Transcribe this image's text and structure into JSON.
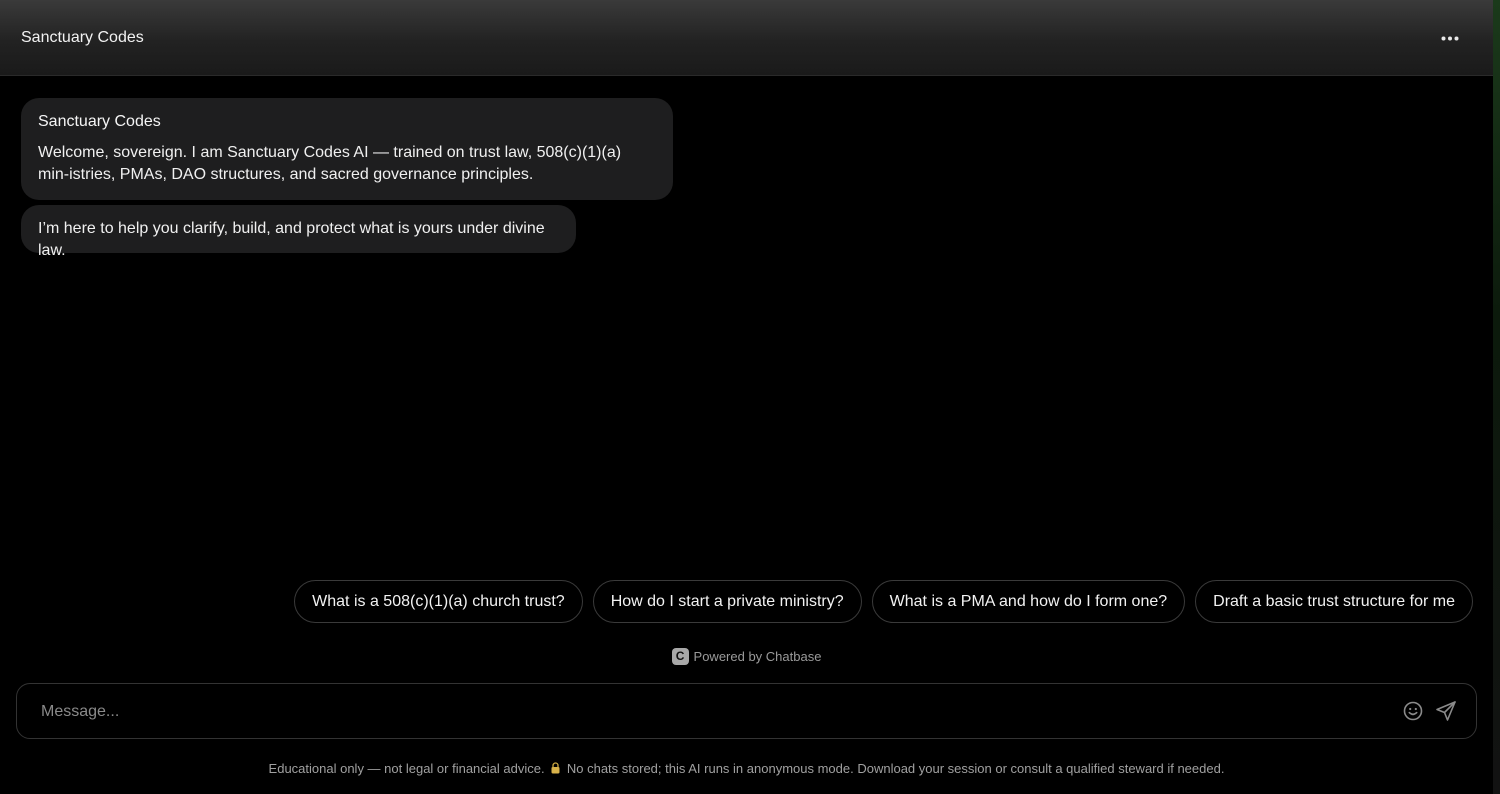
{
  "header": {
    "title": "Sanctuary Codes",
    "menu_icon": "more-horizontal-icon"
  },
  "messages": [
    {
      "sender": "Sanctuary Codes",
      "text": "Welcome, sovereign. I am Sanctuary Codes AI — trained on trust law, 508(c)(1)(a) min-istries, PMAs, DAO structures, and sacred governance principles."
    },
    {
      "sender": "",
      "text": "I’m here to help you clarify, build, and protect what is yours under divine law."
    }
  ],
  "suggestions": [
    "What is a 508(c)(1)(a) church trust?",
    "How do I start a private ministry?",
    "What is a PMA and how do I form one?",
    "Draft a basic trust structure for me"
  ],
  "powered_by": {
    "logo_letter": "C",
    "label": "Powered by Chatbase"
  },
  "composer": {
    "placeholder": "Message...",
    "value": "",
    "emoji_icon": "smiley-icon",
    "send_icon": "send-icon"
  },
  "disclaimer": {
    "part1": "Educational only — not legal or financial advice.",
    "part2": "No chats stored; this AI runs in anonymous mode. Download your session or consult a qualified steward if needed."
  },
  "colors": {
    "background": "#000000",
    "bubble": "#1e1e1f",
    "muted_text": "#a0a0a0",
    "border": "#3a3a3a"
  }
}
